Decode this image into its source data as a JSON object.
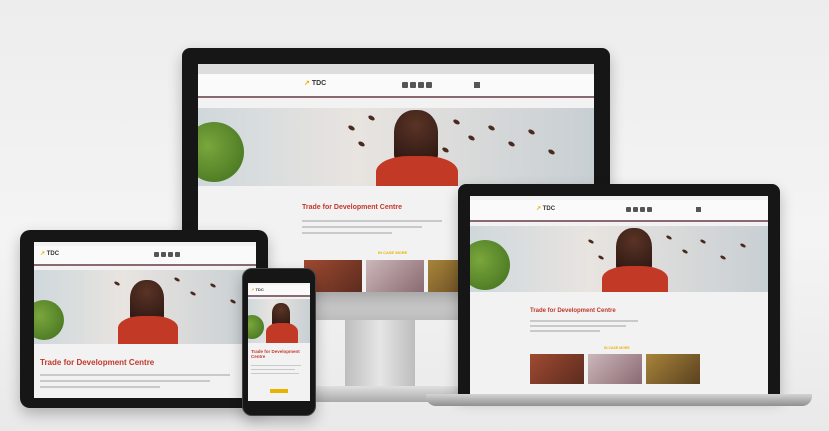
{
  "site": {
    "logo_mark": "↗",
    "logo_text": "TDC",
    "hero_title": "Trade for Development Centre",
    "section_label": "IN CASE MORE"
  },
  "colors": {
    "accent_red": "#c0392b",
    "logo_yellow": "#e8b400",
    "header_border": "#8a6a72",
    "device_black": "#161616"
  },
  "devices": [
    "desktop-monitor",
    "laptop",
    "tablet",
    "smartphone"
  ]
}
